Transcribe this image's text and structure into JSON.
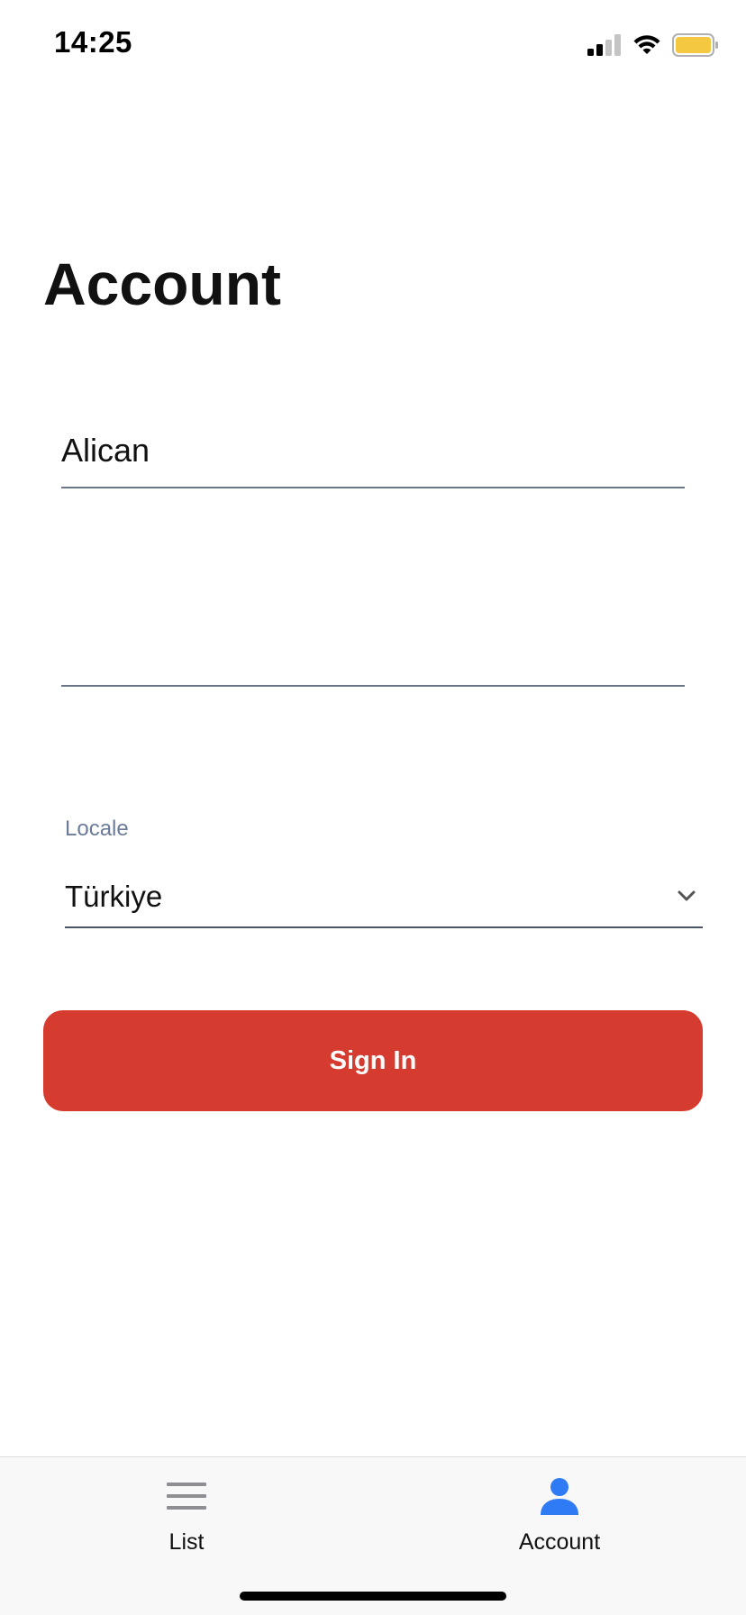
{
  "status_bar": {
    "time": "14:25",
    "signal_icon": "cellular-signal-icon",
    "wifi_icon": "wifi-icon",
    "battery_icon": "battery-icon",
    "battery_color": "#f5c842"
  },
  "page": {
    "title": "Account"
  },
  "form": {
    "name_value": "Alican",
    "second_value": "",
    "locale_label": "Locale",
    "locale_value": "Türkiye",
    "sign_in_label": "Sign In"
  },
  "tab_bar": {
    "items": [
      {
        "label": "List",
        "icon": "list-icon",
        "color": "#8e8e93",
        "active": false
      },
      {
        "label": "Account",
        "icon": "person-icon",
        "color": "#2f7bf5",
        "active": true
      }
    ]
  },
  "colors": {
    "accent": "#d63b30",
    "active_tab": "#2f7bf5"
  }
}
